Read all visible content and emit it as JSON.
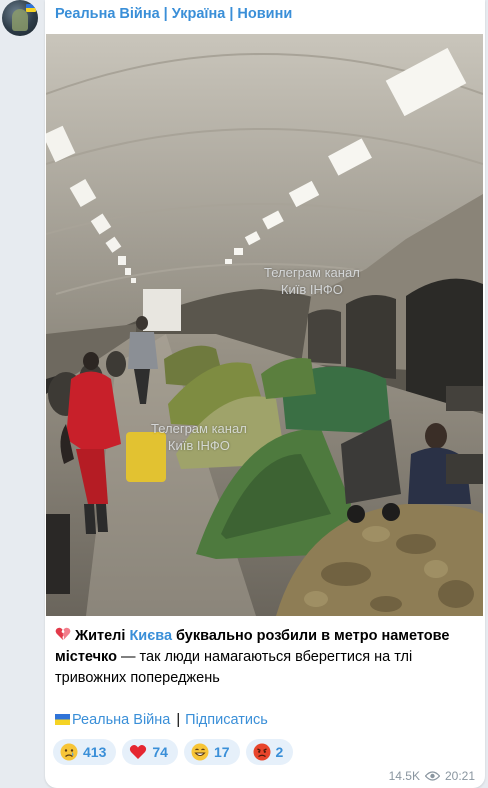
{
  "channel": {
    "name": "Реальна Війна | Україна | Новини"
  },
  "photo": {
    "watermark_1_line1": "Телеграм канал",
    "watermark_1_line2": "Київ ІНФО",
    "watermark_2_line1": "Телеграм канал",
    "watermark_2_line2": "Київ ІНФО"
  },
  "caption": {
    "part1": "Жителі ",
    "link": "Києва",
    "part2": " буквально розбили в метро наметове містечко",
    "part3": " — так люди намагаються вберегтися на тлі тривожних попереджень"
  },
  "footer": {
    "channel_link": "Реальна Війна",
    "separator": "|",
    "subscribe": "Підписатись"
  },
  "reactions": [
    {
      "emoji": "crying-face",
      "count": "413"
    },
    {
      "emoji": "red-heart",
      "count": "74"
    },
    {
      "emoji": "grinning-face",
      "count": "17"
    },
    {
      "emoji": "angry-face",
      "count": "2"
    }
  ],
  "meta": {
    "views": "14.5K",
    "time": "20:21"
  },
  "colors": {
    "accent": "#3a8fd8",
    "bubble": "#ffffff",
    "background": "#e7ebf0",
    "reaction_bg": "#e6f0fa"
  }
}
